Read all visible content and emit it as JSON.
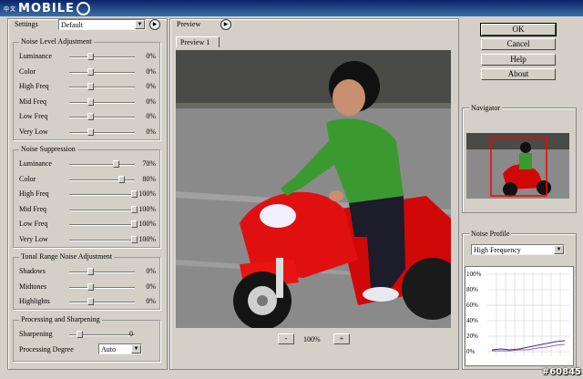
{
  "titlebar": {
    "logo_text": "MOBILE",
    "logo_sup": "中文"
  },
  "settings": {
    "label": "Settings",
    "preset": "Default"
  },
  "noise_level": {
    "title": "Noise Level Adjustment",
    "rows": [
      {
        "label": "Luminance",
        "value": "0%",
        "pct": 0.3
      },
      {
        "label": "Color",
        "value": "0%",
        "pct": 0.3
      },
      {
        "label": "High Freq",
        "value": "0%",
        "pct": 0.3
      },
      {
        "label": "Mid Freq",
        "value": "0%",
        "pct": 0.3
      },
      {
        "label": "Low Freq",
        "value": "0%",
        "pct": 0.3
      },
      {
        "label": "Very Low",
        "value": "0%",
        "pct": 0.3
      }
    ]
  },
  "noise_suppression": {
    "title": "Noise Suppression",
    "rows": [
      {
        "label": "Luminance",
        "value": "70%",
        "pct": 0.7
      },
      {
        "label": "Color",
        "value": "80%",
        "pct": 0.8
      },
      {
        "label": "High Freq",
        "value": "100%",
        "pct": 1.0
      },
      {
        "label": "Mid Freq",
        "value": "100%",
        "pct": 1.0
      },
      {
        "label": "Low Freq",
        "value": "100%",
        "pct": 1.0
      },
      {
        "label": "Very Low",
        "value": "100%",
        "pct": 1.0
      }
    ]
  },
  "tonal": {
    "title": "Tonal Range Noise Adjustment",
    "rows": [
      {
        "label": "Shadows",
        "value": "0%",
        "pct": 0.3
      },
      {
        "label": "Midtones",
        "value": "0%",
        "pct": 0.3
      },
      {
        "label": "Highlights",
        "value": "0%",
        "pct": 0.3
      }
    ]
  },
  "processing": {
    "title": "Processing and Sharpening",
    "sharpening_label": "Sharpening",
    "sharpening_value": "0",
    "degree_label": "Processing Degree",
    "degree_value": "Auto"
  },
  "preview": {
    "label": "Preview",
    "tab": "Preview 1",
    "zoom": "100%",
    "minus": "-",
    "plus": "+"
  },
  "buttons": {
    "ok": "OK",
    "cancel": "Cancel",
    "help": "Help",
    "about": "About"
  },
  "navigator": {
    "label": "Navigator"
  },
  "noise_profile": {
    "label": "Noise Profile",
    "mode": "High Frequency",
    "y_ticks": [
      "100%",
      "80%",
      "60%",
      "40%",
      "20%",
      "0%"
    ]
  },
  "watermark": "#60845",
  "colors": {
    "title_bar": "#0a246a",
    "bike_red": "#e01010",
    "shirt_green": "#3a9a30",
    "nav_rect": "#ff0000",
    "graph_line": "#3030a0"
  }
}
